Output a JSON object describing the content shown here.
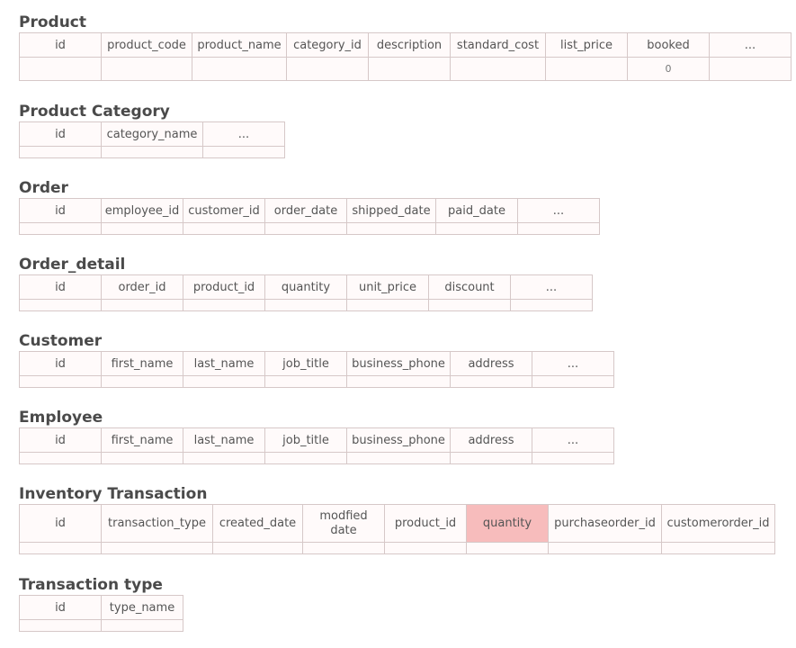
{
  "tables": [
    {
      "title": "Product",
      "columns": [
        "id",
        "product_code",
        "product_name",
        "category_id",
        "description",
        "standard_cost",
        "list_price",
        "booked",
        "..."
      ],
      "values": [
        "",
        "",
        "",
        "",
        "",
        "",
        "",
        "0",
        ""
      ],
      "highlight": -1
    },
    {
      "title": "Product Category",
      "columns": [
        "id",
        "category_name",
        "..."
      ],
      "values": [
        "",
        "",
        ""
      ],
      "highlight": -1
    },
    {
      "title": "Order",
      "columns": [
        "id",
        "employee_id",
        "customer_id",
        "order_date",
        "shipped_date",
        "paid_date",
        "..."
      ],
      "values": [
        "",
        "",
        "",
        "",
        "",
        "",
        ""
      ],
      "highlight": -1
    },
    {
      "title": "Order_detail",
      "columns": [
        "id",
        "order_id",
        "product_id",
        "quantity",
        "unit_price",
        "discount",
        "..."
      ],
      "values": [
        "",
        "",
        "",
        "",
        "",
        "",
        ""
      ],
      "highlight": -1
    },
    {
      "title": "Customer",
      "columns": [
        "id",
        "first_name",
        "last_name",
        "job_title",
        "business_phone",
        "address",
        "..."
      ],
      "values": [
        "",
        "",
        "",
        "",
        "",
        "",
        ""
      ],
      "highlight": -1
    },
    {
      "title": "Employee",
      "columns": [
        "id",
        "first_name",
        "last_name",
        "job_title",
        "business_phone",
        "address",
        "..."
      ],
      "values": [
        "",
        "",
        "",
        "",
        "",
        "",
        ""
      ],
      "highlight": -1
    },
    {
      "title": "Inventory Transaction",
      "columns": [
        "id",
        "transaction_type",
        "created_date",
        "modfied date",
        "product_id",
        "quantity",
        "purchaseorder_id",
        "customerorder_id"
      ],
      "values": [
        "",
        "",
        "",
        "",
        "",
        "",
        "",
        ""
      ],
      "highlight": 5,
      "highlight_color": "#f7bcbc"
    },
    {
      "title": "Transaction type",
      "columns": [
        "id",
        "type_name"
      ],
      "values": [
        "",
        ""
      ],
      "highlight": -1
    }
  ]
}
